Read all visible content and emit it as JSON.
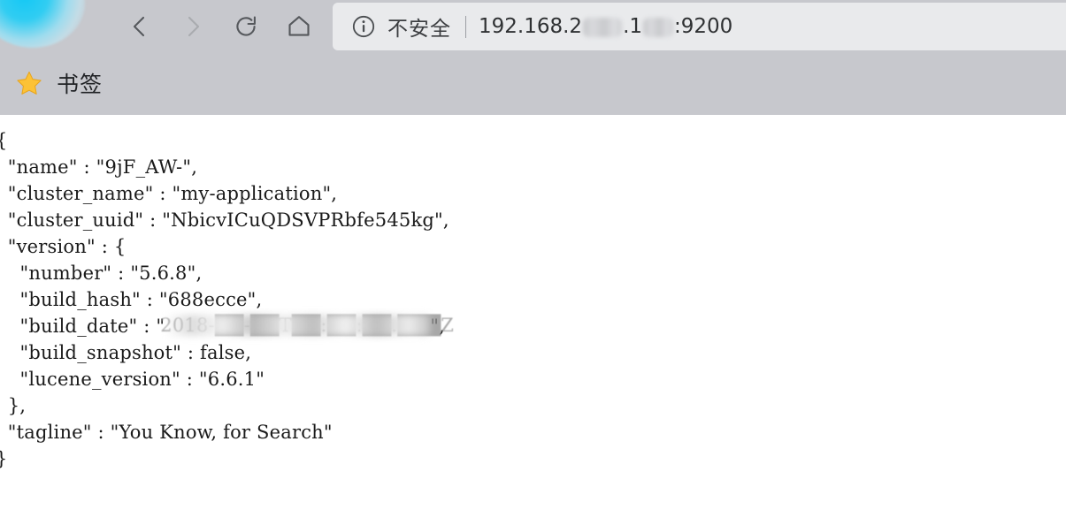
{
  "browser": {
    "nav": {
      "back_label": "后退",
      "forward_label": "前进",
      "reload_label": "重新加载",
      "home_label": "主页"
    },
    "address_bar": {
      "security_label": "不安全",
      "url_prefix": "192.168.2",
      "url_middle": ".1",
      "url_suffix": ":9200",
      "url_full": "192.168.2██.1██:9200",
      "redacted": true
    },
    "bookmarks_bar": {
      "items": [
        {
          "label": "书签",
          "icon": "star-icon"
        }
      ]
    }
  },
  "response": {
    "lines": [
      {
        "text": "{",
        "indent": 0
      },
      {
        "text": "\"name\" : \"9jF_AW-\",",
        "indent": 1
      },
      {
        "text": "\"cluster_name\" : \"my-application\",",
        "indent": 1
      },
      {
        "text": "\"cluster_uuid\" : \"NbicvICuQDSVPRbfe545kg\",",
        "indent": 1
      },
      {
        "text": "\"version\" : {",
        "indent": 1
      },
      {
        "text": "\"number\" : \"5.6.8\",",
        "indent": 2
      },
      {
        "text": "\"build_hash\" : \"688ecce\",",
        "indent": 2
      },
      {
        "text": "\"build_date\" : \"",
        "indent": 2,
        "redacted_tail": "\","
      },
      {
        "text": "\"build_snapshot\" : false,",
        "indent": 2
      },
      {
        "text": "\"lucene_version\" : \"6.6.1\"",
        "indent": 2
      },
      {
        "text": "},",
        "indent": 1
      },
      {
        "text": "\"tagline\" : \"You Know, for Search\"",
        "indent": 1
      },
      {
        "text": "}",
        "indent": 0
      }
    ],
    "fields": {
      "name": "9jF_AW-",
      "cluster_name": "my-application",
      "cluster_uuid": "NbicvICuQDSVPRbfe545kg",
      "version_number": "5.6.8",
      "build_hash": "688ecce",
      "build_date": "2018-██-██T██:██:██.███Z",
      "build_snapshot": "false",
      "lucene_version": "6.6.1",
      "tagline": "You Know, for Search"
    }
  },
  "text": {
    "l0": "{",
    "l1": "  \"name\" : \"9jF_AW-\",",
    "l2": "  \"cluster_name\" : \"my-application\",",
    "l3": "  \"cluster_uuid\" : \"NbicvICuQDSVPRbfe545kg\",",
    "l4": "  \"version\" : {",
    "l5": "    \"number\" : \"5.6.8\",",
    "l6": "    \"build_hash\" : \"688ecce\",",
    "l7_prefix": "    \"build_date\" : \"",
    "l7_suffix": "\",",
    "l8": "    \"build_snapshot\" : false,",
    "l9": "    \"lucene_version\" : \"6.6.1\"",
    "l10": "  },",
    "l11": "  \"tagline\" : \"You Know, for Search\"",
    "l12": "}"
  },
  "colors": {
    "chrome_bg": "#c7c8cd",
    "urlbar_bg": "#e9eaec",
    "page_bg": "#ffffff",
    "text": "#1a1a1a",
    "icon": "#55585c",
    "star": "#fcc236",
    "logo_accent": "#14c8f5"
  }
}
